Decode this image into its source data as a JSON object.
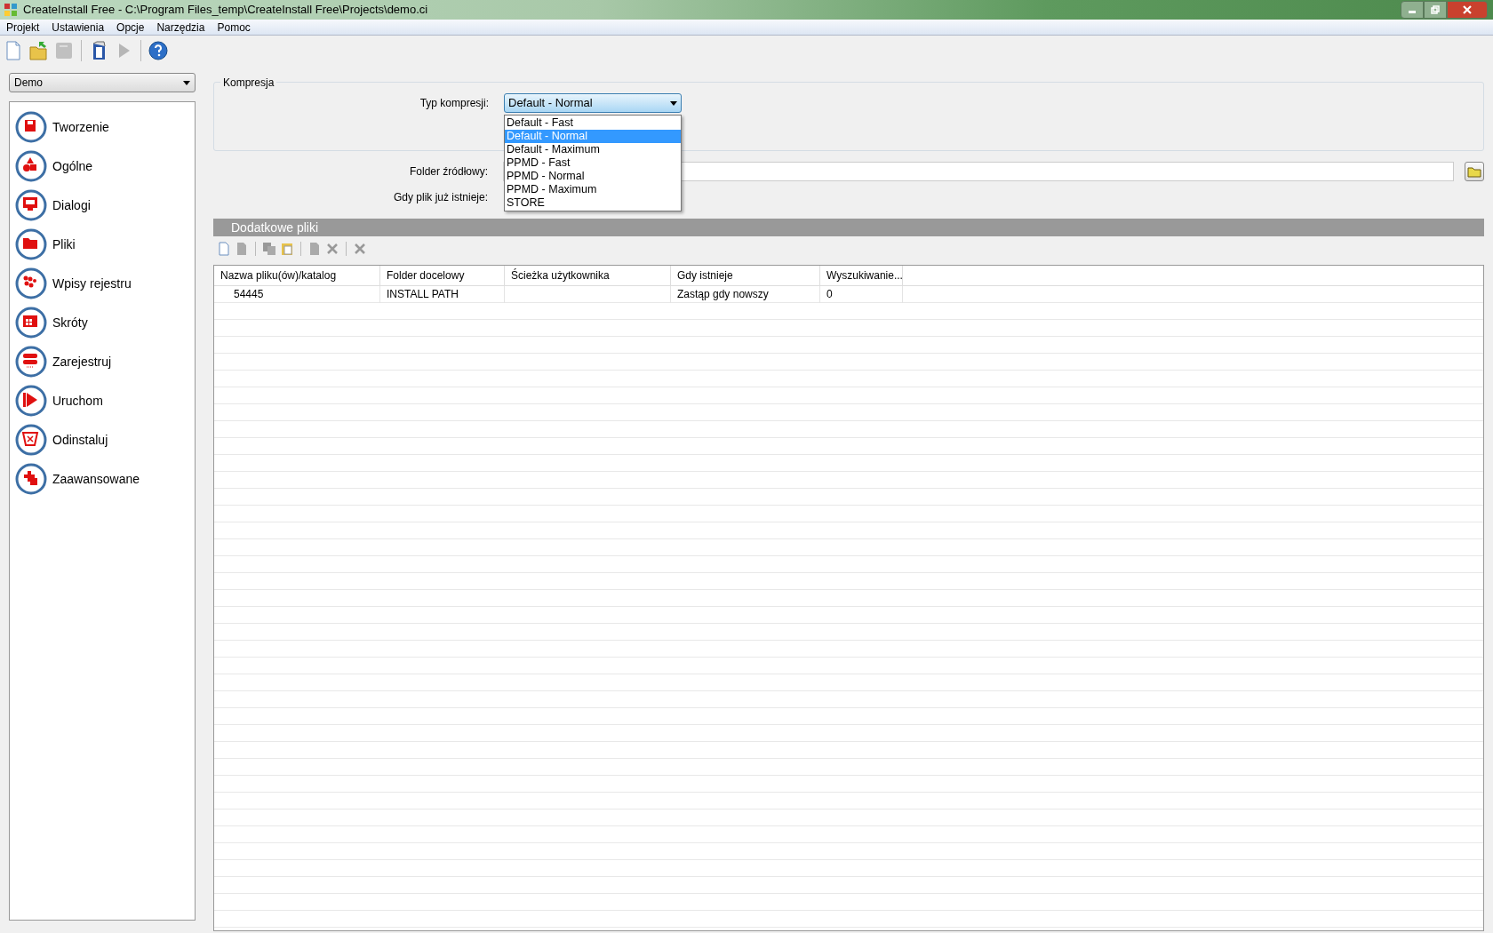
{
  "window": {
    "title": "CreateInstall Free - C:\\Program Files_temp\\CreateInstall Free\\Projects\\demo.ci"
  },
  "menu": [
    "Projekt",
    "Ustawienia",
    "Opcje",
    "Narzędzia",
    "Pomoc"
  ],
  "toolbar": [
    {
      "disabled": false
    },
    {
      "disabled": false
    },
    {
      "disabled": true
    },
    {
      "disabled": false
    },
    {
      "disabled": true
    },
    {
      "disabled": false
    }
  ],
  "project_select": {
    "value": "Demo"
  },
  "sidebar": {
    "items": [
      "Tworzenie",
      "Ogólne",
      "Dialogi",
      "Pliki",
      "Wpisy rejestru",
      "Skróty",
      "Zarejestruj",
      "Uruchom",
      "Odinstaluj",
      "Zaawansowane"
    ]
  },
  "compression": {
    "title": "Kompresja",
    "type_label": "Typ kompresji:",
    "type_value": "Default - Normal",
    "options": [
      {
        "label": "Default - Fast",
        "selected": false
      },
      {
        "label": "Default - Normal",
        "selected": true
      },
      {
        "label": "Default - Maximum",
        "selected": false
      },
      {
        "label": "PPMD - Fast",
        "selected": false
      },
      {
        "label": "PPMD - Normal",
        "selected": false
      },
      {
        "label": "PPMD - Maximum",
        "selected": false
      },
      {
        "label": "STORE",
        "selected": false
      }
    ]
  },
  "source_folder": {
    "label": "Folder źródłowy:"
  },
  "if_exists": {
    "label": "Gdy plik już istnieje:"
  },
  "files_panel": {
    "title": "Dodatkowe pliki",
    "columns": [
      "Nazwa pliku(ów)/katalog",
      "Folder docelowy",
      "Ścieżka użytkownika",
      "Gdy istnieje",
      "Wyszukiwanie..."
    ],
    "rows": [
      {
        "name": "54445",
        "target": "INSTALL PATH",
        "when_exists": "Zastąp gdy nowszy",
        "search": "0"
      }
    ]
  }
}
